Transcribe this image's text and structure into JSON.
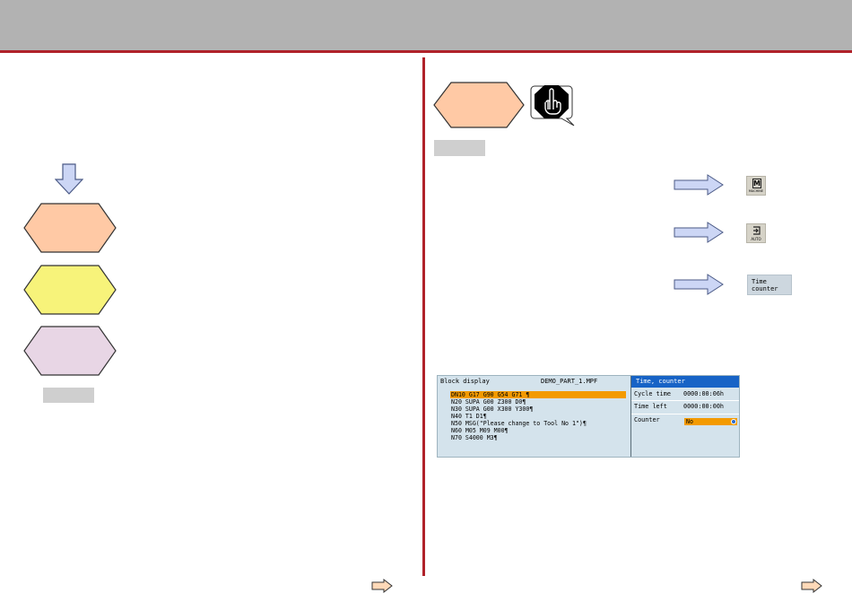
{
  "colors": {
    "header_bg": "#b2b2b2",
    "accent_line": "#b0222a",
    "hex_orange": "#ffc9a5",
    "hex_yellow": "#f7f37a",
    "hex_lilac": "#e8d6e5",
    "arrow_fill": "#ccd6f5",
    "highlight": "#f39a00",
    "title_blue": "#1763c6"
  },
  "left_column": {
    "down_arrow_icon": "down-arrow-icon",
    "shapes": [
      "orange-hexagon",
      "yellow-hexagon",
      "lilac-hexagon"
    ]
  },
  "right_column": {
    "stop_hand_icon": "stop-hand-icon",
    "keys": {
      "machine_key": {
        "letter": "M",
        "caption": "MACHINE"
      },
      "auto_key": {
        "caption": "AUTO"
      },
      "softkey": {
        "line1": "Time",
        "line2": "counter"
      }
    }
  },
  "screen": {
    "block_display": {
      "title": "Block display",
      "program": "DEMO_PART_1.MPF",
      "lines": [
        "DN10 G17 G90 G54 G71 ¶",
        "N20 SUPA G00 Z300 D0¶",
        "N30 SUPA G00 X300 Y300¶",
        "N40 T1 D1¶",
        "N50 MSG(\"Please change to Tool No 1\")¶",
        "N60 M05 M09 M00¶",
        "N70 S4000 M3¶"
      ]
    },
    "time_counter": {
      "title": "Time, counter",
      "cycle_time_label": "Cycle time",
      "cycle_time_value": "0000:00:06h",
      "time_left_label": "Time left",
      "time_left_value": "0000:00:00h",
      "counter_label": "Counter",
      "counter_value": "No"
    }
  },
  "footer": {
    "next_icon": "next-arrow-icon"
  }
}
